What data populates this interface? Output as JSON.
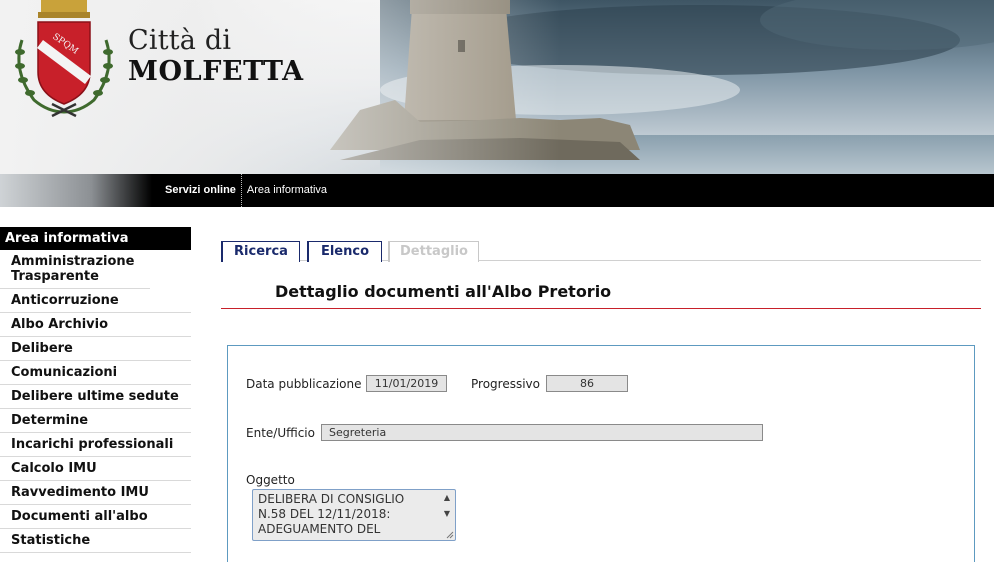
{
  "header": {
    "city_prefix": "Città di",
    "city_name": "MOLFETTA",
    "crest_text": "SPQM"
  },
  "topnav": {
    "items": [
      {
        "label": "Servizi online"
      },
      {
        "label": "Area informativa"
      }
    ]
  },
  "sidebar": {
    "heading": "Area informativa",
    "items": [
      {
        "label": "Amministrazione Trasparente"
      },
      {
        "label": "Anticorruzione"
      },
      {
        "label": "Albo Archivio"
      },
      {
        "label": "Delibere"
      },
      {
        "label": "Comunicazioni"
      },
      {
        "label": "Delibere ultime sedute"
      },
      {
        "label": "Determine"
      },
      {
        "label": "Incarichi professionali"
      },
      {
        "label": "Calcolo IMU"
      },
      {
        "label": "Ravvedimento IMU"
      },
      {
        "label": "Documenti all'albo"
      },
      {
        "label": "Statistiche"
      }
    ]
  },
  "tabs": [
    {
      "label": "Ricerca",
      "enabled": true
    },
    {
      "label": "Elenco",
      "enabled": true
    },
    {
      "label": "Dettaglio",
      "enabled": false
    }
  ],
  "page": {
    "title": "Dettaglio documenti all'Albo Pretorio"
  },
  "detail": {
    "data_pubblicazione_label": "Data pubblicazione",
    "data_pubblicazione_value": "11/01/2019",
    "progressivo_label": "Progressivo",
    "progressivo_value": "86",
    "ente_label": "Ente/Ufficio",
    "ente_value": "Segreteria",
    "oggetto_label": "Oggetto",
    "oggetto_value": "DELIBERA DI CONSIGLIO\nN.58 DEL 12/11/2018:\nADEGUAMENTO DEL"
  },
  "colors": {
    "tab_border": "#1a2a6c",
    "title_rule": "#c7202a",
    "box_border": "#5d9ac0",
    "crest_red": "#c8202a"
  }
}
